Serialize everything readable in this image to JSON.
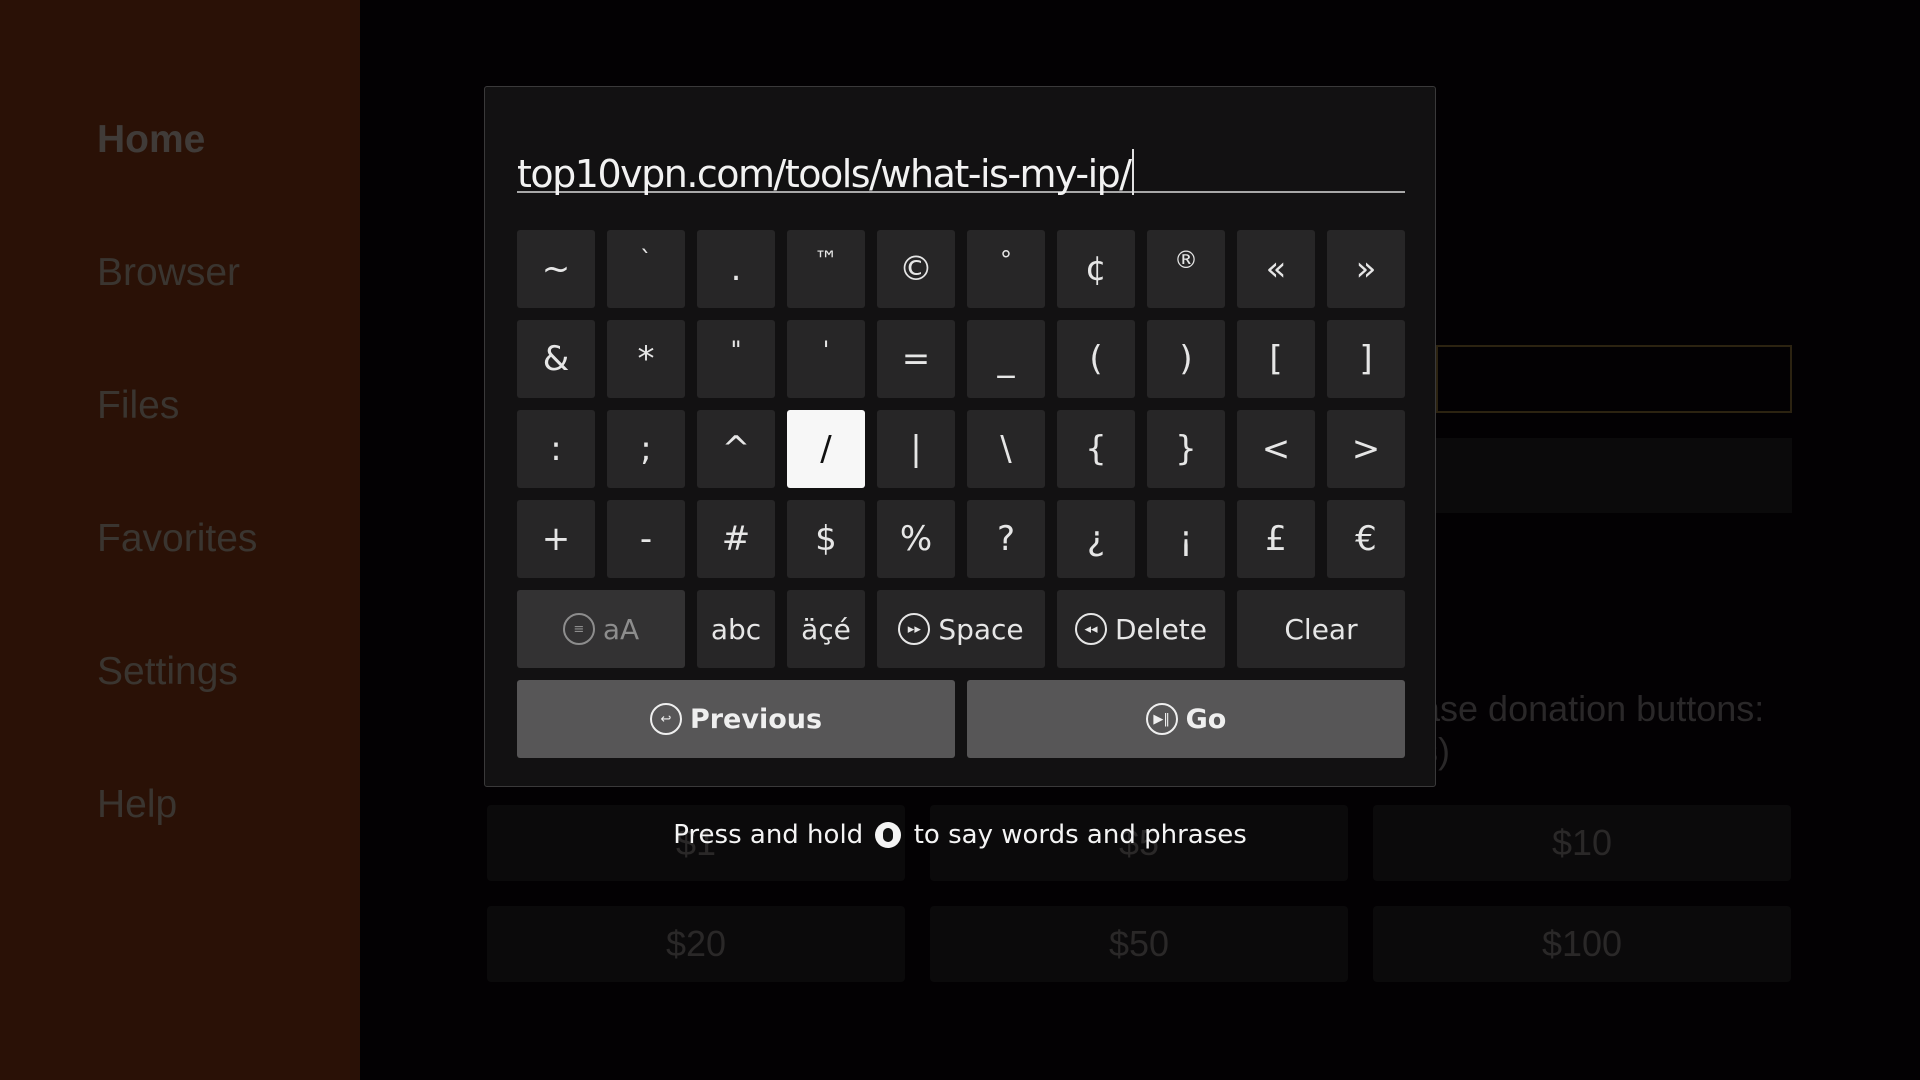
{
  "sidebar": {
    "items": [
      {
        "label": "Home",
        "active": true
      },
      {
        "label": "Browser",
        "active": false
      },
      {
        "label": "Files",
        "active": false
      },
      {
        "label": "Favorites",
        "active": false
      },
      {
        "label": "Settings",
        "active": false
      },
      {
        "label": "Help",
        "active": false
      }
    ]
  },
  "background": {
    "donation_text_line1": "ase donation buttons:",
    "donation_text_line2": "s)",
    "donation_buttons": [
      "$1",
      "$5",
      "$10",
      "$20",
      "$50",
      "$100"
    ]
  },
  "keyboard": {
    "url_value": "top10vpn.com/tools/what-is-my-ip/",
    "rows": [
      [
        "~",
        "`",
        ".",
        "™",
        "©",
        "°",
        "¢",
        "®",
        "«",
        "»"
      ],
      [
        "&",
        "*",
        "\"",
        "'",
        "=",
        "_",
        "(",
        ")",
        "[",
        "]"
      ],
      [
        ":",
        ";",
        "^",
        "/",
        "|",
        "\\",
        "{",
        "}",
        "<",
        ">"
      ],
      [
        "+",
        "-",
        "#",
        "$",
        "%",
        "?",
        "¿",
        "¡",
        "£",
        "€"
      ]
    ],
    "selected_key": "/",
    "function_keys": {
      "case_toggle": {
        "label": "aA",
        "icon": "menu-icon",
        "disabled": true
      },
      "abc": {
        "label": "abc"
      },
      "accents": {
        "label": "äçé"
      },
      "space": {
        "label": "Space",
        "icon": "fast-forward-icon"
      },
      "delete": {
        "label": "Delete",
        "icon": "rewind-icon"
      },
      "clear": {
        "label": "Clear"
      }
    },
    "previous": {
      "label": "Previous",
      "icon": "back-icon"
    },
    "go": {
      "label": "Go",
      "icon": "play-pause-icon"
    }
  },
  "hint": {
    "before": "Press and hold",
    "icon": "microphone-icon",
    "after": "to say words and phrases"
  },
  "colors": {
    "sidebar_bg": "#2a1106",
    "dialog_bg": "#121112",
    "key_bg": "#272627",
    "key_selected_bg": "#f7f7f7",
    "action_button_bg": "#575657"
  }
}
